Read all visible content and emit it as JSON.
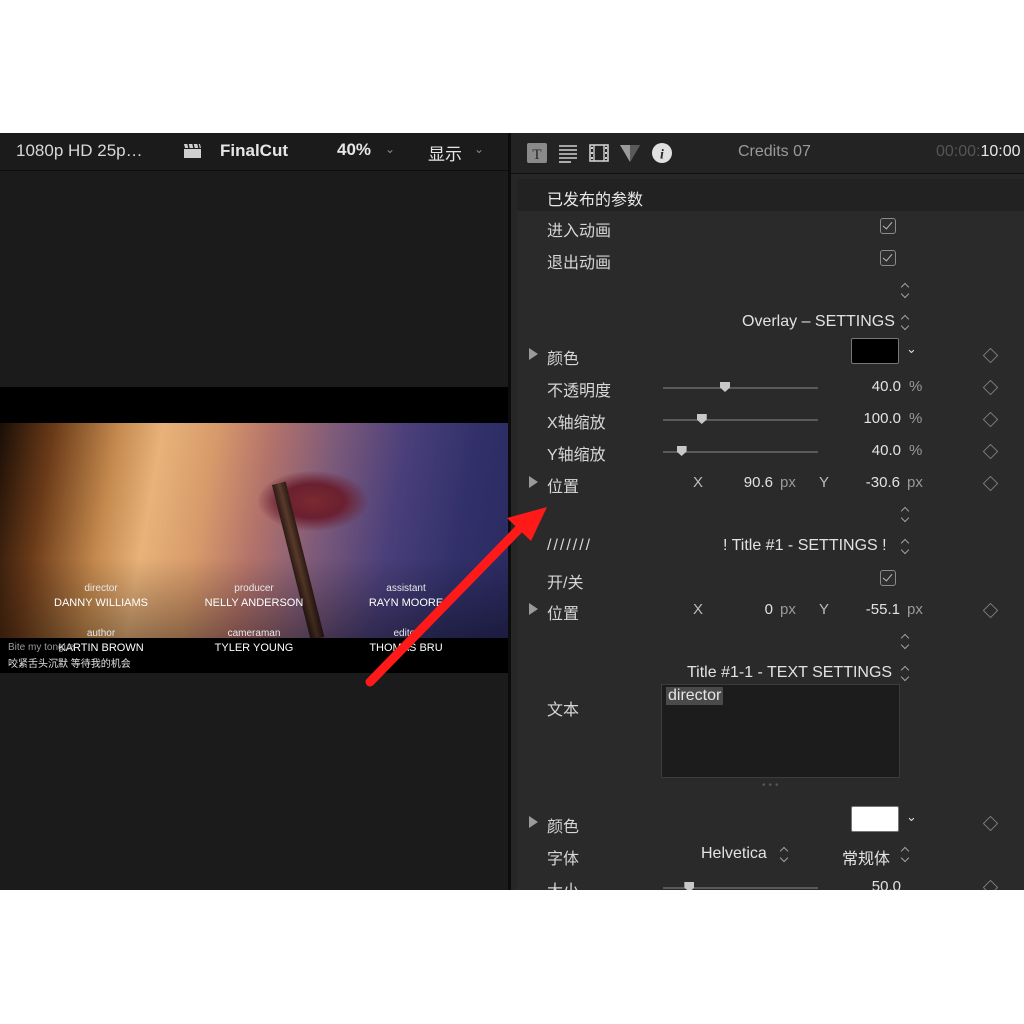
{
  "viewer": {
    "format": "1080p HD 25p…",
    "project": "FinalCut",
    "zoom": "40%",
    "display": "显示",
    "credits": [
      {
        "role": "director",
        "name": "DANNY WILLIAMS"
      },
      {
        "role": "producer",
        "name": "NELLY ANDERSON"
      },
      {
        "role": "assistant",
        "name": "RAYN MOORE"
      },
      {
        "role": "author",
        "name": "KARTIN BROWN"
      },
      {
        "role": "cameraman",
        "name": "TYLER YOUNG"
      },
      {
        "role": "editor",
        "name": "THOMAS BRU"
      }
    ],
    "subtitle_en": "Bite my tongue",
    "subtitle_cn": "咬紧舌头沉默 等待我的机会"
  },
  "inspector": {
    "title": "Credits 07",
    "timecode_dim": "00:00:",
    "timecode": "10:00",
    "section_header": "已发布的参数",
    "build_in": "进入动画",
    "build_out": "退出动画",
    "overlay_settings": "Overlay – SETTINGS",
    "color_label": "颜色",
    "opacity_label": "不透明度",
    "opacity_value": "40.0",
    "x_scale_label": "X轴缩放",
    "x_scale_value": "100.0",
    "y_scale_label": "Y轴缩放",
    "y_scale_value": "40.0",
    "percent": "%",
    "position_label": "位置",
    "x_axis": "X",
    "y_axis": "Y",
    "pos1_x": "90.6",
    "pos1_y": "-30.6",
    "px": "px",
    "slashes": "///////",
    "title1_settings": "! Title #1 - SETTINGS !",
    "onoff_label": "开/关",
    "pos2_x": "0",
    "pos2_y": "-55.1",
    "title11_settings": "Title #1-1 - TEXT SETTINGS",
    "text_label": "文本",
    "text_value": "director",
    "font_label": "字体",
    "font_family": "Helvetica",
    "font_style": "常规体",
    "size_label": "大小",
    "size_value": "50.0",
    "overlay_color": "#000000",
    "text_color": "#ffffff",
    "slider_fractions": {
      "opacity": 0.4,
      "x_scale": 0.25,
      "y_scale": 0.12,
      "size": 0.17
    }
  }
}
